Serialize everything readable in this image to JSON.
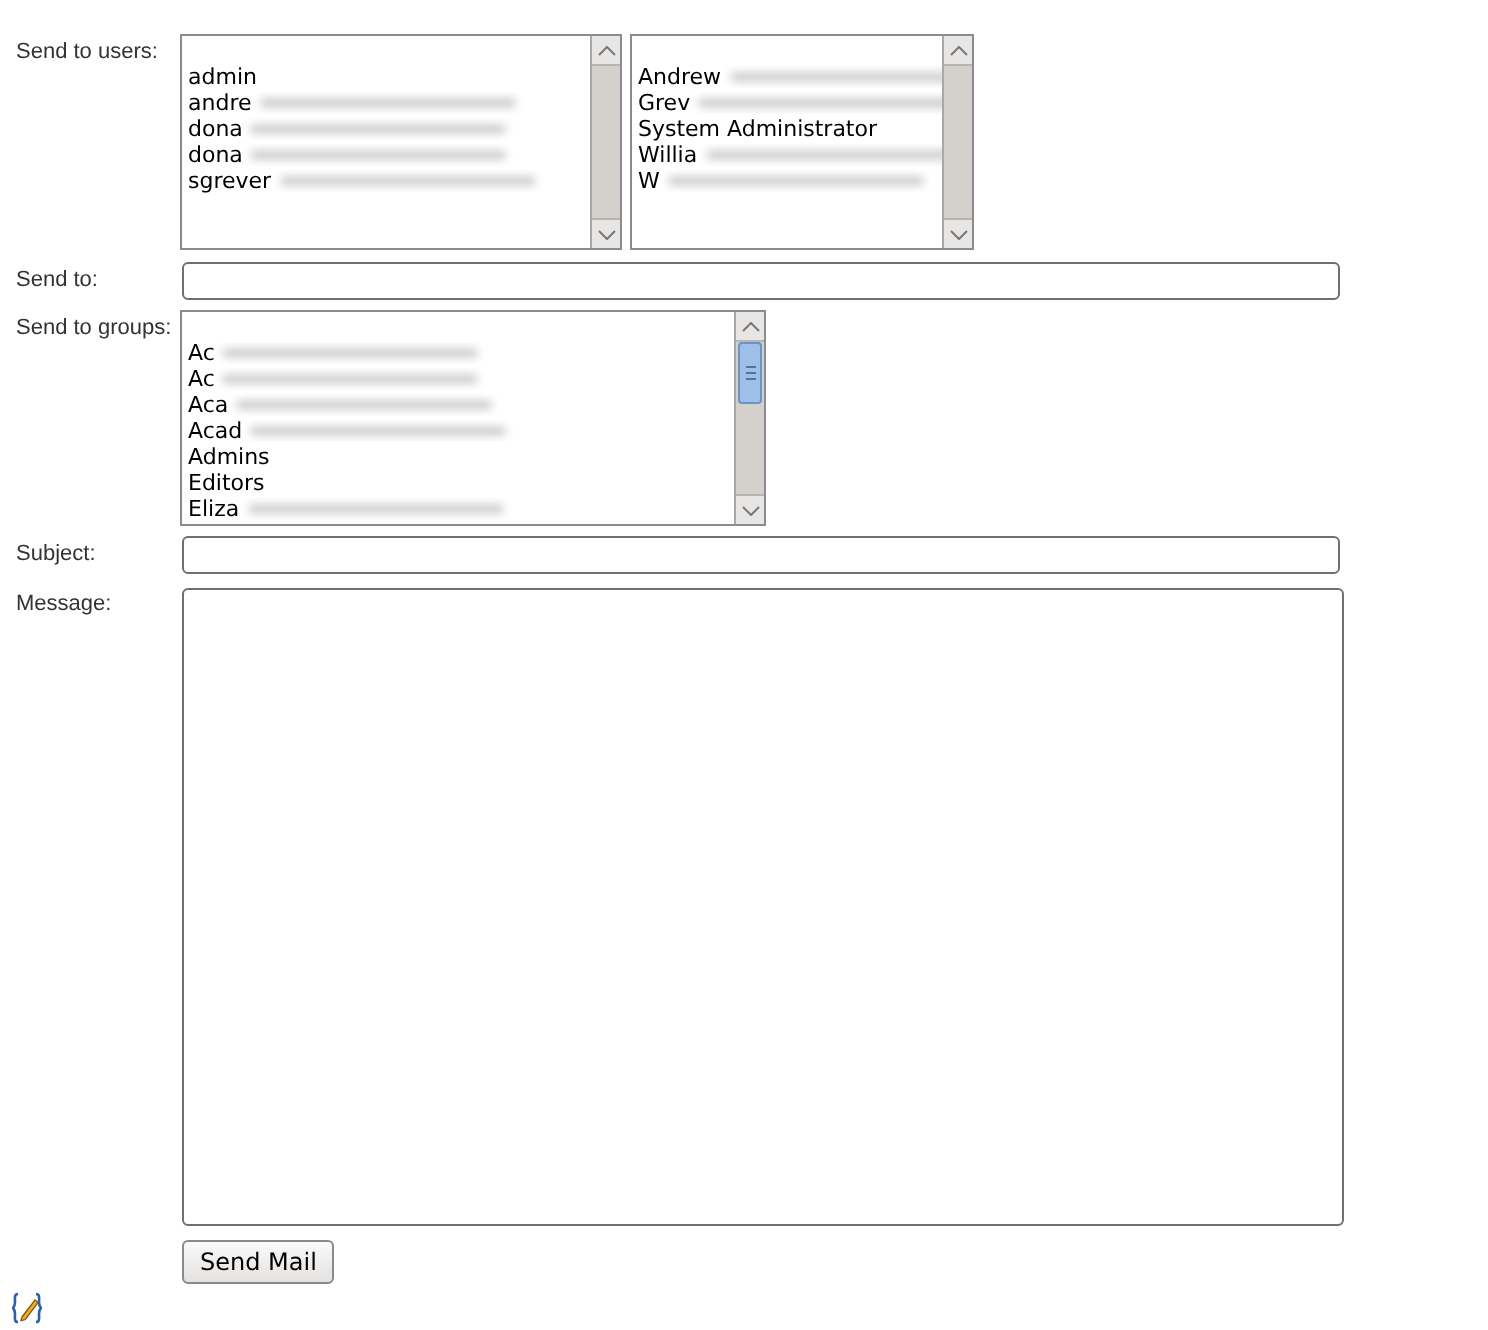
{
  "send_to_users": {
    "label": "Send to users:",
    "usernames": [
      {
        "text": "admin",
        "redacted": false
      },
      {
        "text": "andre",
        "redacted": true
      },
      {
        "text": "dona",
        "redacted": true
      },
      {
        "text": "dona",
        "redacted": true
      },
      {
        "text": "sgrever",
        "redacted": true
      }
    ],
    "full_names": [
      {
        "text": "Andrew",
        "redacted": true
      },
      {
        "text": "Grev",
        "redacted": true
      },
      {
        "text": "System Administrator",
        "redacted": false
      },
      {
        "text": "Willia",
        "redacted": true
      },
      {
        "text": "W",
        "redacted": true
      }
    ]
  },
  "send_to": {
    "label": "Send to:"
  },
  "send_to_groups": {
    "label": "Send to groups:",
    "items": [
      {
        "text": "Ac",
        "redacted": true
      },
      {
        "text": "Ac",
        "redacted": true
      },
      {
        "text": "Aca",
        "redacted": true
      },
      {
        "text": "Acad",
        "redacted": true
      },
      {
        "text": "Admins",
        "redacted": false
      },
      {
        "text": "Editors",
        "redacted": false
      },
      {
        "text": "Eliza",
        "redacted": true
      }
    ]
  },
  "subject": {
    "label": "Subject:"
  },
  "message": {
    "label": "Message:"
  },
  "send_button": "Send Mail"
}
